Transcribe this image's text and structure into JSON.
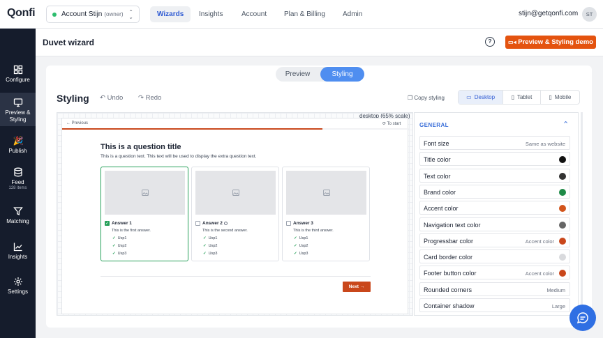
{
  "app": {
    "logo": "Qonfi"
  },
  "account": {
    "name": "Account Stijn",
    "role": "(owner)"
  },
  "nav": [
    {
      "label": "Wizards",
      "active": true
    },
    {
      "label": "Insights",
      "active": false
    },
    {
      "label": "Account",
      "active": false
    },
    {
      "label": "Plan & Billing",
      "active": false
    },
    {
      "label": "Admin",
      "active": false
    }
  ],
  "user": {
    "email": "stijn@getqonfi.com",
    "initials": "ST"
  },
  "sidebar": {
    "items": [
      {
        "label": "Configure",
        "icon": "layout-icon"
      },
      {
        "label": "Preview & Styling",
        "icon": "monitor-icon",
        "active": true
      },
      {
        "label": "Publish",
        "icon": "party-popper-icon"
      },
      {
        "label": "Feed",
        "sub": "128 items",
        "icon": "database-icon"
      },
      {
        "label": "Matching",
        "icon": "filter-icon"
      },
      {
        "label": "Insights",
        "icon": "chart-line-icon"
      },
      {
        "label": "Settings",
        "icon": "gear-icon"
      }
    ]
  },
  "header": {
    "title": "Duvet wizard",
    "demo_button": "Preview & Styling demo"
  },
  "mode_toggle": {
    "preview": "Preview",
    "styling": "Styling"
  },
  "toolbar": {
    "title": "Styling",
    "undo": "Undo",
    "redo": "Redo",
    "copy": "Copy styling",
    "devices": [
      {
        "label": "Desktop",
        "active": true
      },
      {
        "label": "Tablet",
        "active": false
      },
      {
        "label": "Mobile",
        "active": false
      }
    ]
  },
  "preview": {
    "scale_label": "desktop (65% scale)",
    "previous": "← Previous",
    "to_start": "To start",
    "progress": 0.75,
    "question_title": "This is a question title",
    "question_text": "This is a question text. This text will be used to display the extra question text.",
    "answers": [
      {
        "title": "Answer 1",
        "desc": "This is the first answer.",
        "usps": [
          "Usp1",
          "Usp2",
          "Usp3"
        ],
        "selected": true,
        "info": false
      },
      {
        "title": "Answer 2",
        "desc": "This is the second answer.",
        "usps": [
          "Usp1",
          "Usp2",
          "Usp3"
        ],
        "selected": false,
        "info": true
      },
      {
        "title": "Answer 3",
        "desc": "This is the third answer.",
        "usps": [
          "Usp1",
          "Usp2",
          "Usp3"
        ],
        "selected": false,
        "info": false
      }
    ],
    "next_button": "Next →"
  },
  "settings": {
    "section": "GENERAL",
    "rows": [
      {
        "label": "Font size",
        "value": "Same as website",
        "color": null
      },
      {
        "label": "Title color",
        "value": "",
        "color": "#111111"
      },
      {
        "label": "Text color",
        "value": "",
        "color": "#333333"
      },
      {
        "label": "Brand color",
        "value": "",
        "color": "#1e8a47"
      },
      {
        "label": "Accent color",
        "value": "",
        "color": "#d2541b"
      },
      {
        "label": "Navigation text color",
        "value": "",
        "color": "#666666"
      },
      {
        "label": "Progressbar color",
        "value": "Accent color",
        "color": "#c9471b"
      },
      {
        "label": "Card border color",
        "value": "",
        "color": "#d9dadd"
      },
      {
        "label": "Footer button color",
        "value": "Accent color",
        "color": "#c9471b"
      },
      {
        "label": "Rounded corners",
        "value": "Medium",
        "color": null
      },
      {
        "label": "Container shadow",
        "value": "Large",
        "color": null
      }
    ]
  },
  "colors": {
    "accent": "#e4530f",
    "brand_blue": "#2f6fe3",
    "success": "#27a05a"
  }
}
